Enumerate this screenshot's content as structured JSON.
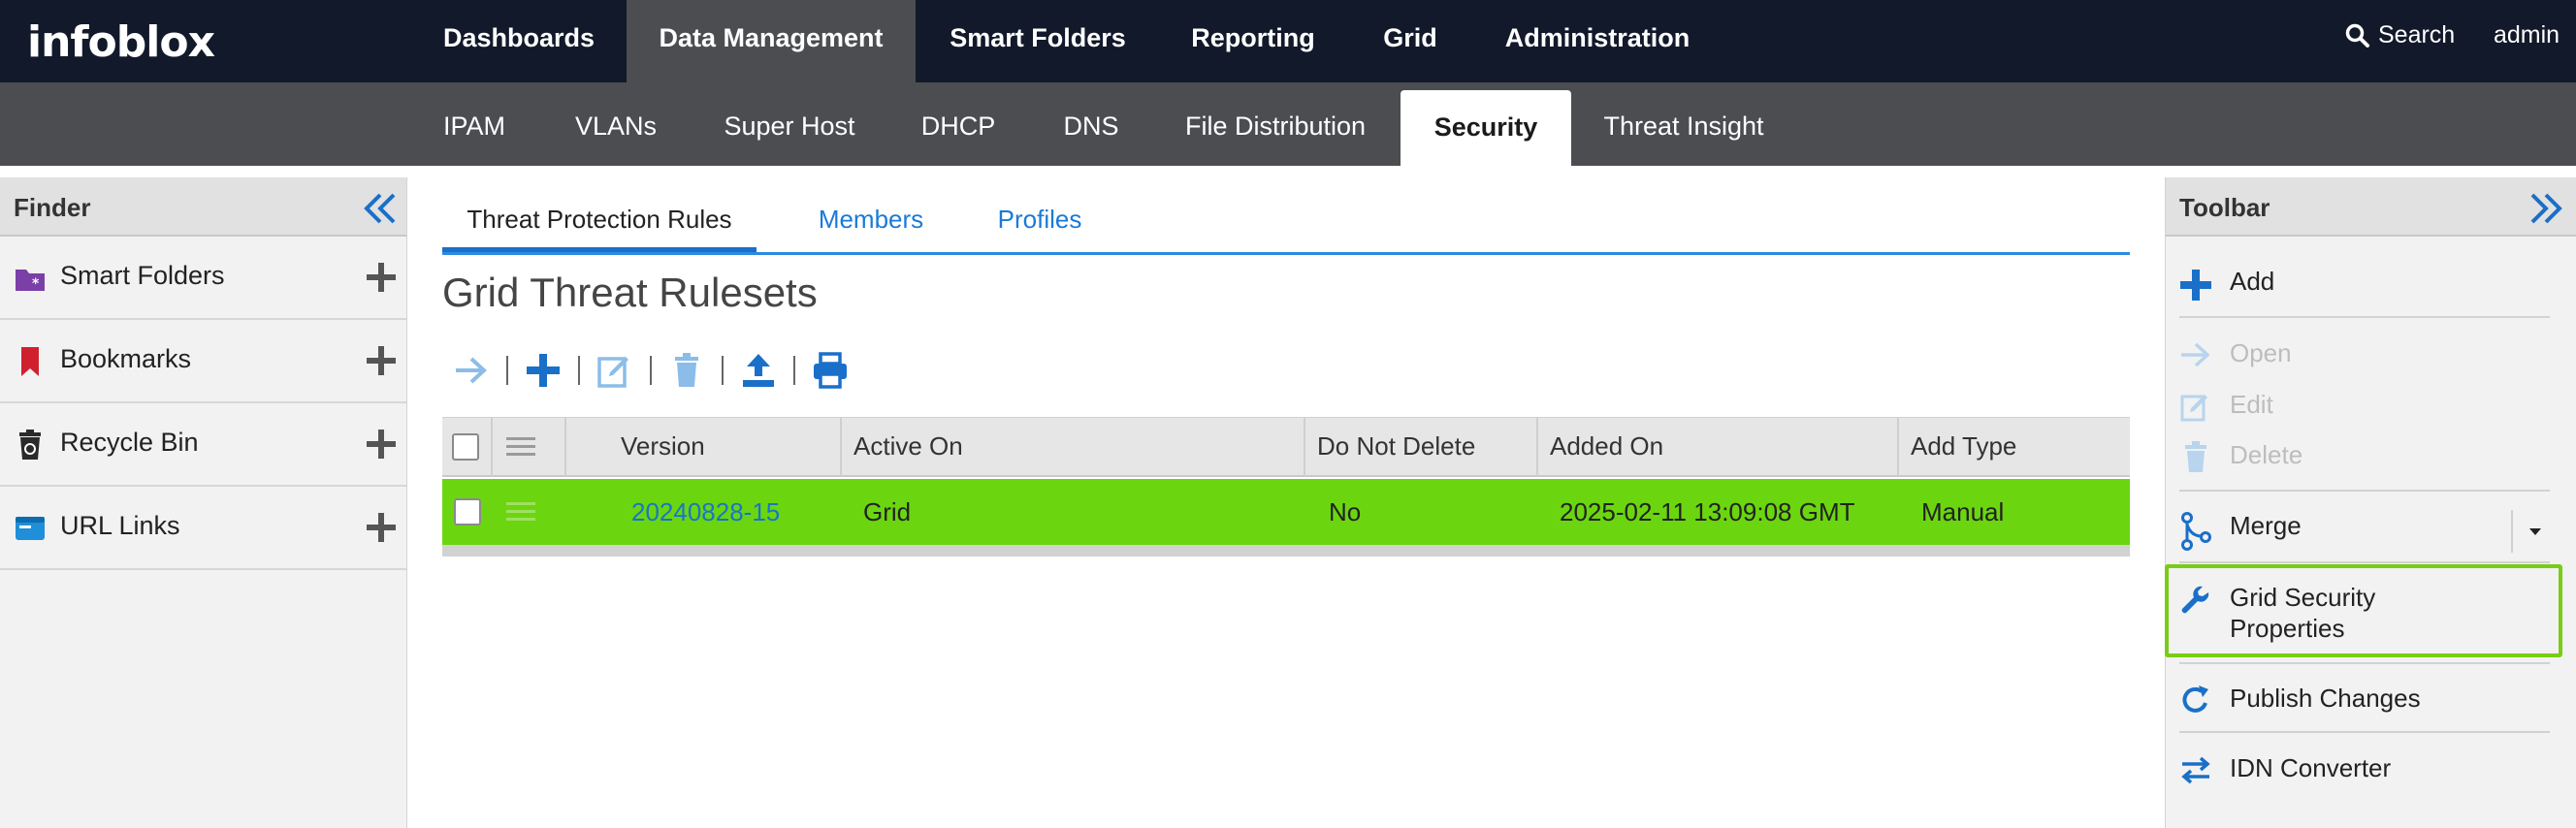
{
  "app": {
    "logo": "infoblox",
    "search_label": "Search",
    "user": "admin"
  },
  "top_nav": [
    {
      "label": "Dashboards"
    },
    {
      "label": "Data Management"
    },
    {
      "label": "Smart Folders"
    },
    {
      "label": "Reporting"
    },
    {
      "label": "Grid"
    },
    {
      "label": "Administration"
    }
  ],
  "top_nav_active": "Data Management",
  "sub_nav": [
    {
      "label": "IPAM"
    },
    {
      "label": "VLANs"
    },
    {
      "label": "Super Host"
    },
    {
      "label": "DHCP"
    },
    {
      "label": "DNS"
    },
    {
      "label": "File Distribution"
    },
    {
      "label": "Security"
    },
    {
      "label": "Threat Insight"
    }
  ],
  "sub_nav_active": "Security",
  "finder": {
    "title": "Finder",
    "items": [
      {
        "label": "Smart Folders",
        "icon": "smart-folder-icon"
      },
      {
        "label": "Bookmarks",
        "icon": "bookmark-icon"
      },
      {
        "label": "Recycle Bin",
        "icon": "recycle-bin-icon"
      },
      {
        "label": "URL Links",
        "icon": "url-links-icon"
      }
    ]
  },
  "main": {
    "tabs": [
      {
        "label": "Threat Protection Rules"
      },
      {
        "label": "Members"
      },
      {
        "label": "Profiles"
      }
    ],
    "active_tab": "Threat Protection Rules",
    "title": "Grid Threat Rulesets",
    "table": {
      "columns": [
        "Version",
        "Active On",
        "Do Not Delete",
        "Added On",
        "Add Type"
      ],
      "rows": [
        {
          "version": "20240828-15",
          "active_on": "Grid",
          "do_not_delete": "No",
          "added_on": "2025-02-11 13:09:08 GMT",
          "add_type": "Manual",
          "selected": true
        }
      ]
    }
  },
  "toolbar": {
    "title": "Toolbar",
    "items": [
      {
        "label": "Add",
        "icon": "plus-icon",
        "enabled": true
      },
      {
        "label": "Open",
        "icon": "arrow-right-icon",
        "enabled": false
      },
      {
        "label": "Edit",
        "icon": "edit-icon",
        "enabled": false
      },
      {
        "label": "Delete",
        "icon": "trash-icon",
        "enabled": false
      },
      {
        "label": "Merge",
        "icon": "merge-icon",
        "enabled": true
      },
      {
        "label": "Grid Security Properties",
        "label_line1": "Grid Security",
        "label_line2": "Properties",
        "icon": "wrench-icon",
        "enabled": true,
        "highlighted": true
      },
      {
        "label": "Publish Changes",
        "icon": "refresh-icon",
        "enabled": true
      },
      {
        "label": "IDN Converter",
        "icon": "swap-arrows-icon",
        "enabled": true
      }
    ]
  },
  "colors": {
    "topbar": "#12192a",
    "subbar": "#4b4d50",
    "accent_blue": "#1a6fc9",
    "selected_row": "#6bd60f",
    "highlight": "#79cc16"
  }
}
